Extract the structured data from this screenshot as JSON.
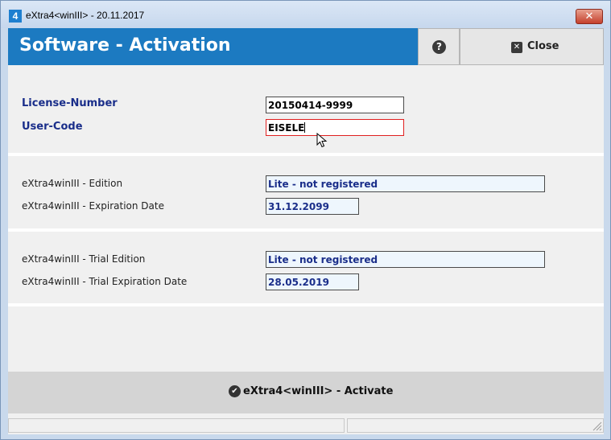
{
  "window": {
    "title": "eXtra4<winIII>  -  20.11.2017",
    "close_glyph": "✕"
  },
  "header": {
    "title": "Software - Activation",
    "help_glyph": "?",
    "close_label": "Close",
    "close_glyph": "✕"
  },
  "form": {
    "license_label": "License-Number",
    "license_value": "20150414-9999",
    "usercode_label": "User-Code",
    "usercode_value": "EISELE"
  },
  "edition": {
    "edition_label": "eXtra4winIII - Edition",
    "edition_value": "Lite - not registered",
    "expiry_label": "eXtra4winIII - Expiration Date",
    "expiry_value": "31.12.2099"
  },
  "trial": {
    "edition_label": "eXtra4winIII - Trial Edition",
    "edition_value": "Lite - not registered",
    "expiry_label": "eXtra4winIII - Trial Expiration Date",
    "expiry_value": "28.05.2019"
  },
  "footer": {
    "activate_label": "eXtra4<winIII>  - Activate",
    "check_glyph": "✔"
  },
  "colors": {
    "header_blue": "#1c7ac1",
    "label_blue": "#1a2e8a",
    "error_red": "#e02020"
  }
}
